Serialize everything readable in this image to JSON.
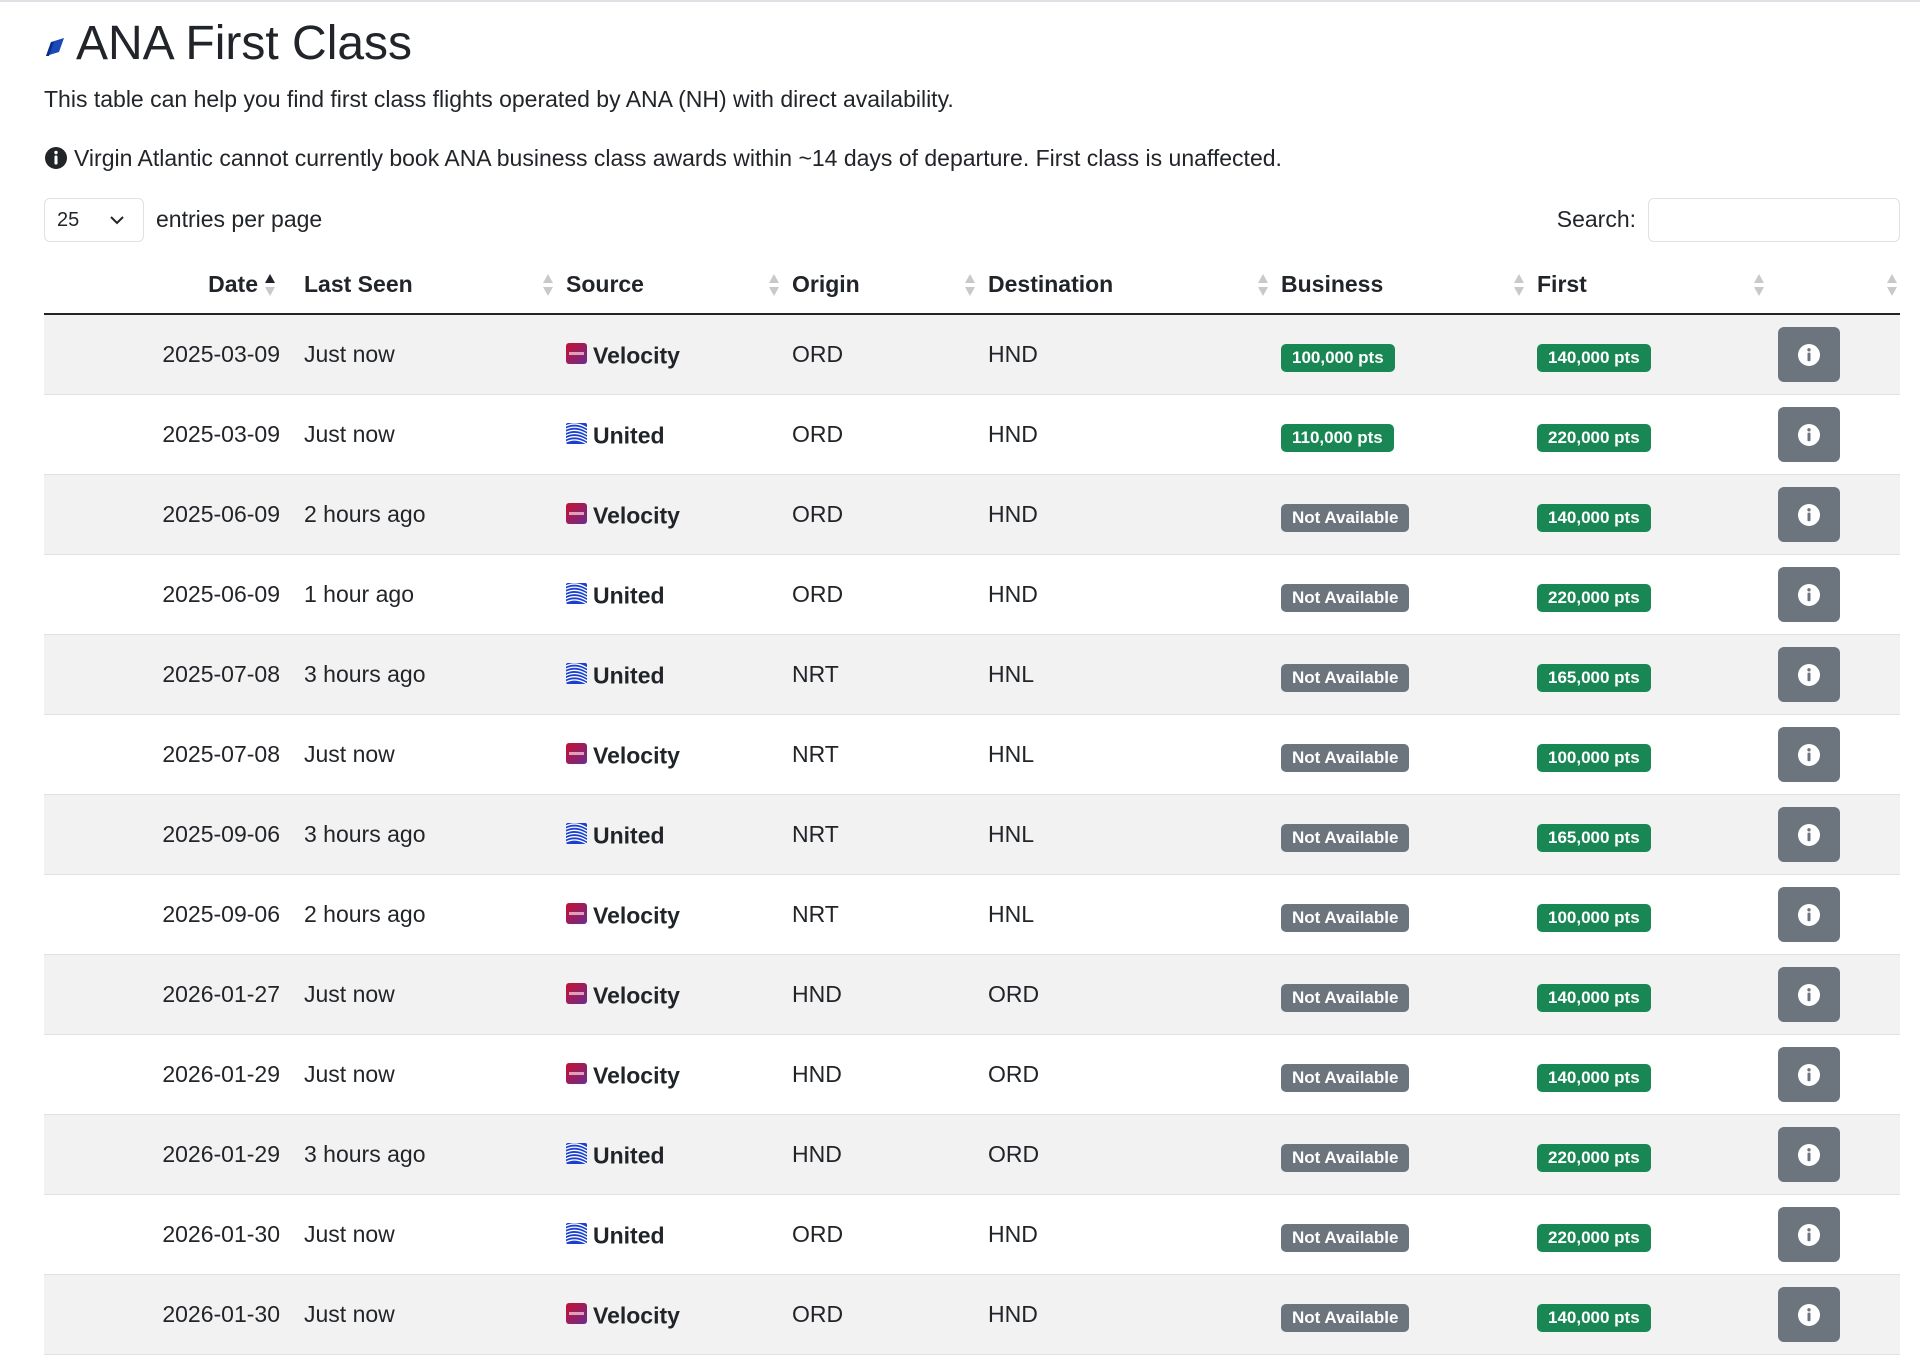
{
  "page": {
    "title": "ANA First Class",
    "intro": "This table can help you find first class flights operated by ANA (NH) with direct availability.",
    "notice": "Virgin Atlantic cannot currently book ANA business class awards within ~14 days of departure. First class is unaffected."
  },
  "controls": {
    "entries_value": "25",
    "entries_label": "entries per page",
    "search_label": "Search:",
    "search_value": ""
  },
  "table": {
    "headers": [
      "Date",
      "Last Seen",
      "Source",
      "Origin",
      "Destination",
      "Business",
      "First",
      ""
    ],
    "sorted_column": "Date",
    "sort_direction": "ascending",
    "rows": [
      {
        "date": "2025-03-09",
        "last_seen": "Just now",
        "source": "Velocity",
        "source_icon": "velocity-logo-icon",
        "origin": "ORD",
        "destination": "HND",
        "business": "100,000 pts",
        "business_available": true,
        "first": "140,000 pts"
      },
      {
        "date": "2025-03-09",
        "last_seen": "Just now",
        "source": "United",
        "source_icon": "united-globe-icon",
        "origin": "ORD",
        "destination": "HND",
        "business": "110,000 pts",
        "business_available": true,
        "first": "220,000 pts"
      },
      {
        "date": "2025-06-09",
        "last_seen": "2 hours ago",
        "source": "Velocity",
        "source_icon": "velocity-logo-icon",
        "origin": "ORD",
        "destination": "HND",
        "business": "Not Available",
        "business_available": false,
        "first": "140,000 pts"
      },
      {
        "date": "2025-06-09",
        "last_seen": "1 hour ago",
        "source": "United",
        "source_icon": "united-globe-icon",
        "origin": "ORD",
        "destination": "HND",
        "business": "Not Available",
        "business_available": false,
        "first": "220,000 pts"
      },
      {
        "date": "2025-07-08",
        "last_seen": "3 hours ago",
        "source": "United",
        "source_icon": "united-globe-icon",
        "origin": "NRT",
        "destination": "HNL",
        "business": "Not Available",
        "business_available": false,
        "first": "165,000 pts"
      },
      {
        "date": "2025-07-08",
        "last_seen": "Just now",
        "source": "Velocity",
        "source_icon": "velocity-logo-icon",
        "origin": "NRT",
        "destination": "HNL",
        "business": "Not Available",
        "business_available": false,
        "first": "100,000 pts"
      },
      {
        "date": "2025-09-06",
        "last_seen": "3 hours ago",
        "source": "United",
        "source_icon": "united-globe-icon",
        "origin": "NRT",
        "destination": "HNL",
        "business": "Not Available",
        "business_available": false,
        "first": "165,000 pts"
      },
      {
        "date": "2025-09-06",
        "last_seen": "2 hours ago",
        "source": "Velocity",
        "source_icon": "velocity-logo-icon",
        "origin": "NRT",
        "destination": "HNL",
        "business": "Not Available",
        "business_available": false,
        "first": "100,000 pts"
      },
      {
        "date": "2026-01-27",
        "last_seen": "Just now",
        "source": "Velocity",
        "source_icon": "velocity-logo-icon",
        "origin": "HND",
        "destination": "ORD",
        "business": "Not Available",
        "business_available": false,
        "first": "140,000 pts"
      },
      {
        "date": "2026-01-29",
        "last_seen": "Just now",
        "source": "Velocity",
        "source_icon": "velocity-logo-icon",
        "origin": "HND",
        "destination": "ORD",
        "business": "Not Available",
        "business_available": false,
        "first": "140,000 pts"
      },
      {
        "date": "2026-01-29",
        "last_seen": "3 hours ago",
        "source": "United",
        "source_icon": "united-globe-icon",
        "origin": "HND",
        "destination": "ORD",
        "business": "Not Available",
        "business_available": false,
        "first": "220,000 pts"
      },
      {
        "date": "2026-01-30",
        "last_seen": "Just now",
        "source": "United",
        "source_icon": "united-globe-icon",
        "origin": "ORD",
        "destination": "HND",
        "business": "Not Available",
        "business_available": false,
        "first": "220,000 pts"
      },
      {
        "date": "2026-01-30",
        "last_seen": "Just now",
        "source": "Velocity",
        "source_icon": "velocity-logo-icon",
        "origin": "ORD",
        "destination": "HND",
        "business": "Not Available",
        "business_available": false,
        "first": "140,000 pts"
      }
    ]
  },
  "colors": {
    "available_badge": "#198754",
    "unavailable_badge": "#6c757d",
    "info_button": "#6c757d",
    "striped_row": "#f2f2f2",
    "ana_logo": "#1b4ab8"
  },
  "icons": {
    "title": "ana-logo-icon",
    "notice": "info-circle-icon",
    "row_action": "info-icon"
  }
}
